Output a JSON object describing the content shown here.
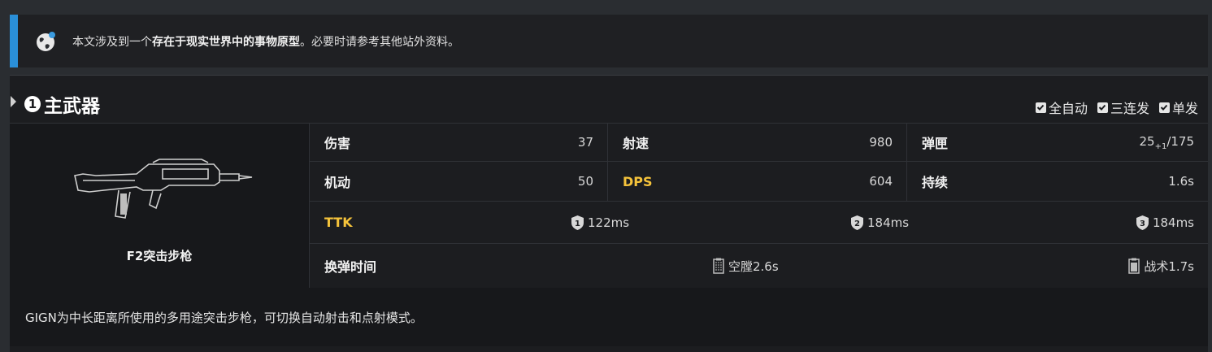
{
  "notice": {
    "icon": "globe-icon",
    "text_before": "本文涉及到一个",
    "text_bold": "存在于现实世界中的事物原型",
    "text_after": "。必要时请参考其他站外资料。",
    "accent": "#2a8fd8"
  },
  "primary": {
    "badge": "1",
    "title": "主武器",
    "modes": [
      {
        "label": "全自动",
        "checked": true
      },
      {
        "label": "三连发",
        "checked": true
      },
      {
        "label": "单发",
        "checked": true
      }
    ],
    "weapon_name": "F2突击步枪",
    "stats": {
      "damage": {
        "label": "伤害",
        "value": "37"
      },
      "rate": {
        "label": "射速",
        "value": "980"
      },
      "mag": {
        "label": "弹匣",
        "value_main": "25",
        "value_sub": "+1",
        "value_rest": "/175"
      },
      "mobility": {
        "label": "机动",
        "value": "50"
      },
      "dps": {
        "label": "DPS",
        "value": "604"
      },
      "duration": {
        "label": "持续",
        "value": "1.6s"
      }
    },
    "ttk": {
      "label": "TTK",
      "items": [
        {
          "armor": "1",
          "value": "122ms"
        },
        {
          "armor": "2",
          "value": "184ms"
        },
        {
          "armor": "3",
          "value": "184ms"
        }
      ]
    },
    "reload": {
      "label": "换弹时间",
      "empty": "空膛2.6s",
      "tactical": "战术1.7s"
    },
    "description": "GIGN为中长距离所使用的多用途突击步枪，可切换自动射击和点射模式。",
    "highlight_color": "#f5c33b"
  }
}
